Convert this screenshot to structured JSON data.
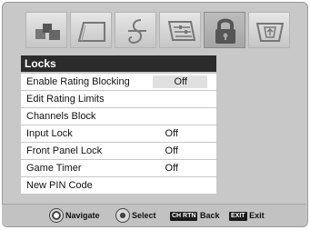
{
  "tabs": [
    {
      "icon": "picture-icon",
      "active": false
    },
    {
      "icon": "display-icon",
      "active": false
    },
    {
      "icon": "audio-icon",
      "active": false
    },
    {
      "icon": "setup-icon",
      "active": false
    },
    {
      "icon": "lock-icon",
      "active": true
    },
    {
      "icon": "applications-icon",
      "active": false
    }
  ],
  "section_title": "Locks",
  "menu": [
    {
      "label": "Enable Rating Blocking",
      "value": "Off"
    },
    {
      "label": "Edit Rating Limits",
      "value": ""
    },
    {
      "label": "Channels Block",
      "value": ""
    },
    {
      "label": "Input Lock",
      "value": "Off"
    },
    {
      "label": "Front Panel Lock",
      "value": "Off"
    },
    {
      "label": "Game Timer",
      "value": "Off"
    },
    {
      "label": "New PIN Code",
      "value": ""
    }
  ],
  "footer": {
    "navigate": "Navigate",
    "select": "Select",
    "back_key": "CH RTN",
    "back": "Back",
    "exit_key": "EXIT",
    "exit": "Exit"
  }
}
